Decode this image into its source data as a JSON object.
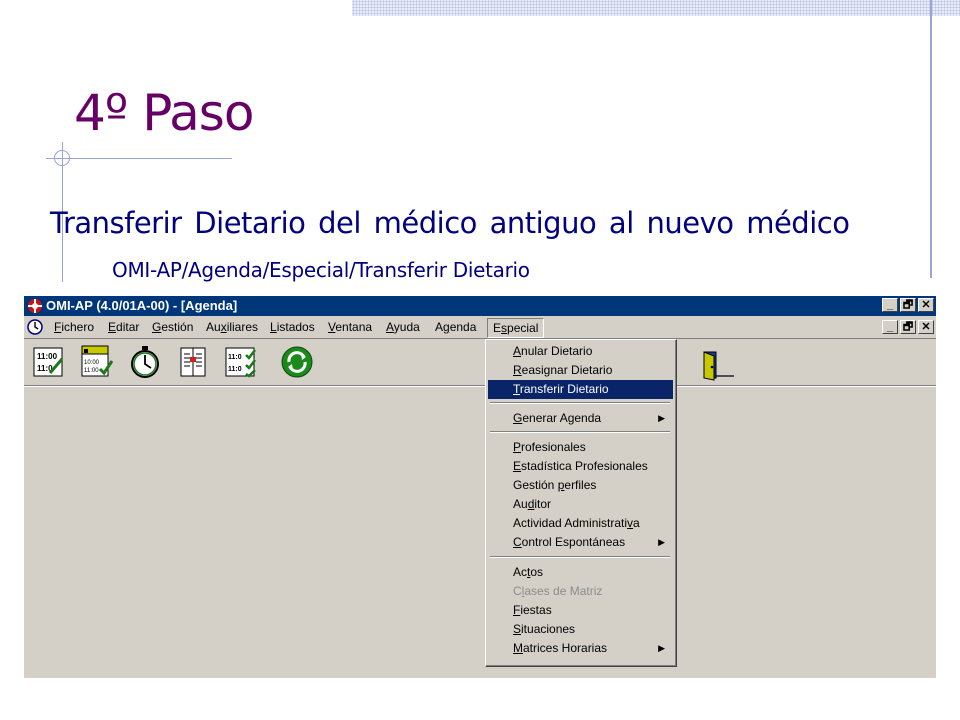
{
  "slide": {
    "title": "4º Paso",
    "subtitle": "Transferir Dietario del médico antiguo al nuevo médico",
    "path": "OMI-AP/Agenda/Especial/Transferir Dietario"
  },
  "window": {
    "title": "OMI-AP (4.0/01A-00) - [Agenda]",
    "buttons": [
      "_",
      "🗗",
      "✕"
    ]
  },
  "menubar": {
    "items": [
      {
        "label": "Fichero",
        "mnemonic": "F"
      },
      {
        "label": "Editar",
        "mnemonic": "E"
      },
      {
        "label": "Gestión",
        "mnemonic": "G"
      },
      {
        "label": "Auxiliares",
        "mnemonic": "x"
      },
      {
        "label": "Listados",
        "mnemonic": "L"
      },
      {
        "label": "Ventana",
        "mnemonic": "V"
      },
      {
        "label": "Ayuda",
        "mnemonic": "A"
      },
      {
        "label": "Agenda",
        "mnemonic": "g"
      },
      {
        "label": "Especial",
        "mnemonic": "s",
        "active": true
      }
    ]
  },
  "toolbar": {
    "icons": [
      "clock-list-icon",
      "calendar-check-icon",
      "stopwatch-icon",
      "book-icon",
      "schedule-checklist-icon",
      "refresh-icon"
    ],
    "clock_texts": [
      "11:00",
      "11:0",
      "10:00",
      "11:00",
      "11:0",
      "11:0"
    ]
  },
  "dropdown": {
    "items": [
      {
        "label": "Anular Dietario",
        "u": "A"
      },
      {
        "label": "Reasignar Dietario",
        "u": "R"
      },
      {
        "label": "Transferir Dietario",
        "u": "T",
        "selected": true
      },
      {
        "sep": true
      },
      {
        "label": "Generar Agenda",
        "u": "G",
        "submenu": true
      },
      {
        "sep": true
      },
      {
        "label": "Profesionales",
        "u": "P"
      },
      {
        "label": "Estadística Profesionales",
        "u": "E"
      },
      {
        "label": "Gestión perfiles",
        "u": "p"
      },
      {
        "label": "Auditor",
        "u": "d"
      },
      {
        "label": "Actividad Administrativa",
        "u": "v"
      },
      {
        "label": "Control Espontáneas",
        "u": "C",
        "submenu": true
      },
      {
        "sep": true
      },
      {
        "label": "Actos",
        "u": "t"
      },
      {
        "label": "Clases de Matriz",
        "u": "l",
        "disabled": true
      },
      {
        "label": "Fiestas",
        "u": "F"
      },
      {
        "label": "Situaciones",
        "u": "S"
      },
      {
        "label": "Matrices Horarias",
        "u": "M",
        "submenu": true
      }
    ]
  },
  "colors": {
    "title": "#660066",
    "text": "#000080",
    "titlebar": "#00367a",
    "selection": "#0a246a",
    "face": "#d4d0c8"
  }
}
